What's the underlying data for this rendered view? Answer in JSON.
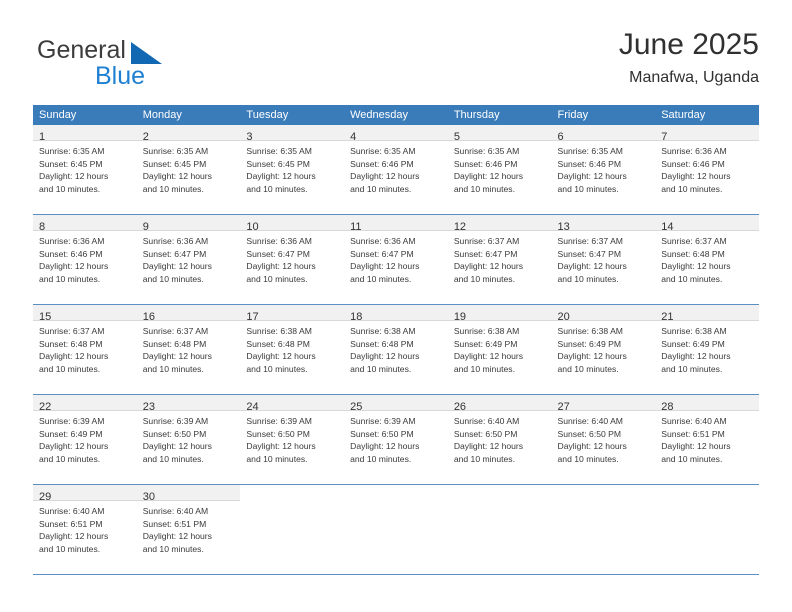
{
  "brand": {
    "name_part1": "General",
    "name_part2": "Blue",
    "triangle_icon": "brand-triangle-icon",
    "accent_color": "#1268b3",
    "blue_text_color": "#1f80d2"
  },
  "header": {
    "title": "June 2025",
    "subtitle": "Manafwa, Uganda"
  },
  "calendar": {
    "header_bg_color": "#3a7cba",
    "header_text_color": "#ffffff",
    "daynum_bg_color": "#f1f1f1",
    "grid_line_color": "#5b8fc4",
    "weekdays": [
      "Sunday",
      "Monday",
      "Tuesday",
      "Wednesday",
      "Thursday",
      "Friday",
      "Saturday"
    ],
    "weeks": [
      [
        {
          "day": "1",
          "sunrise": "Sunrise: 6:35 AM",
          "sunset": "Sunset: 6:45 PM",
          "daylight_line1": "Daylight: 12 hours",
          "daylight_line2": "and 10 minutes."
        },
        {
          "day": "2",
          "sunrise": "Sunrise: 6:35 AM",
          "sunset": "Sunset: 6:45 PM",
          "daylight_line1": "Daylight: 12 hours",
          "daylight_line2": "and 10 minutes."
        },
        {
          "day": "3",
          "sunrise": "Sunrise: 6:35 AM",
          "sunset": "Sunset: 6:45 PM",
          "daylight_line1": "Daylight: 12 hours",
          "daylight_line2": "and 10 minutes."
        },
        {
          "day": "4",
          "sunrise": "Sunrise: 6:35 AM",
          "sunset": "Sunset: 6:46 PM",
          "daylight_line1": "Daylight: 12 hours",
          "daylight_line2": "and 10 minutes."
        },
        {
          "day": "5",
          "sunrise": "Sunrise: 6:35 AM",
          "sunset": "Sunset: 6:46 PM",
          "daylight_line1": "Daylight: 12 hours",
          "daylight_line2": "and 10 minutes."
        },
        {
          "day": "6",
          "sunrise": "Sunrise: 6:35 AM",
          "sunset": "Sunset: 6:46 PM",
          "daylight_line1": "Daylight: 12 hours",
          "daylight_line2": "and 10 minutes."
        },
        {
          "day": "7",
          "sunrise": "Sunrise: 6:36 AM",
          "sunset": "Sunset: 6:46 PM",
          "daylight_line1": "Daylight: 12 hours",
          "daylight_line2": "and 10 minutes."
        }
      ],
      [
        {
          "day": "8",
          "sunrise": "Sunrise: 6:36 AM",
          "sunset": "Sunset: 6:46 PM",
          "daylight_line1": "Daylight: 12 hours",
          "daylight_line2": "and 10 minutes."
        },
        {
          "day": "9",
          "sunrise": "Sunrise: 6:36 AM",
          "sunset": "Sunset: 6:47 PM",
          "daylight_line1": "Daylight: 12 hours",
          "daylight_line2": "and 10 minutes."
        },
        {
          "day": "10",
          "sunrise": "Sunrise: 6:36 AM",
          "sunset": "Sunset: 6:47 PM",
          "daylight_line1": "Daylight: 12 hours",
          "daylight_line2": "and 10 minutes."
        },
        {
          "day": "11",
          "sunrise": "Sunrise: 6:36 AM",
          "sunset": "Sunset: 6:47 PM",
          "daylight_line1": "Daylight: 12 hours",
          "daylight_line2": "and 10 minutes."
        },
        {
          "day": "12",
          "sunrise": "Sunrise: 6:37 AM",
          "sunset": "Sunset: 6:47 PM",
          "daylight_line1": "Daylight: 12 hours",
          "daylight_line2": "and 10 minutes."
        },
        {
          "day": "13",
          "sunrise": "Sunrise: 6:37 AM",
          "sunset": "Sunset: 6:47 PM",
          "daylight_line1": "Daylight: 12 hours",
          "daylight_line2": "and 10 minutes."
        },
        {
          "day": "14",
          "sunrise": "Sunrise: 6:37 AM",
          "sunset": "Sunset: 6:48 PM",
          "daylight_line1": "Daylight: 12 hours",
          "daylight_line2": "and 10 minutes."
        }
      ],
      [
        {
          "day": "15",
          "sunrise": "Sunrise: 6:37 AM",
          "sunset": "Sunset: 6:48 PM",
          "daylight_line1": "Daylight: 12 hours",
          "daylight_line2": "and 10 minutes."
        },
        {
          "day": "16",
          "sunrise": "Sunrise: 6:37 AM",
          "sunset": "Sunset: 6:48 PM",
          "daylight_line1": "Daylight: 12 hours",
          "daylight_line2": "and 10 minutes."
        },
        {
          "day": "17",
          "sunrise": "Sunrise: 6:38 AM",
          "sunset": "Sunset: 6:48 PM",
          "daylight_line1": "Daylight: 12 hours",
          "daylight_line2": "and 10 minutes."
        },
        {
          "day": "18",
          "sunrise": "Sunrise: 6:38 AM",
          "sunset": "Sunset: 6:48 PM",
          "daylight_line1": "Daylight: 12 hours",
          "daylight_line2": "and 10 minutes."
        },
        {
          "day": "19",
          "sunrise": "Sunrise: 6:38 AM",
          "sunset": "Sunset: 6:49 PM",
          "daylight_line1": "Daylight: 12 hours",
          "daylight_line2": "and 10 minutes."
        },
        {
          "day": "20",
          "sunrise": "Sunrise: 6:38 AM",
          "sunset": "Sunset: 6:49 PM",
          "daylight_line1": "Daylight: 12 hours",
          "daylight_line2": "and 10 minutes."
        },
        {
          "day": "21",
          "sunrise": "Sunrise: 6:38 AM",
          "sunset": "Sunset: 6:49 PM",
          "daylight_line1": "Daylight: 12 hours",
          "daylight_line2": "and 10 minutes."
        }
      ],
      [
        {
          "day": "22",
          "sunrise": "Sunrise: 6:39 AM",
          "sunset": "Sunset: 6:49 PM",
          "daylight_line1": "Daylight: 12 hours",
          "daylight_line2": "and 10 minutes."
        },
        {
          "day": "23",
          "sunrise": "Sunrise: 6:39 AM",
          "sunset": "Sunset: 6:50 PM",
          "daylight_line1": "Daylight: 12 hours",
          "daylight_line2": "and 10 minutes."
        },
        {
          "day": "24",
          "sunrise": "Sunrise: 6:39 AM",
          "sunset": "Sunset: 6:50 PM",
          "daylight_line1": "Daylight: 12 hours",
          "daylight_line2": "and 10 minutes."
        },
        {
          "day": "25",
          "sunrise": "Sunrise: 6:39 AM",
          "sunset": "Sunset: 6:50 PM",
          "daylight_line1": "Daylight: 12 hours",
          "daylight_line2": "and 10 minutes."
        },
        {
          "day": "26",
          "sunrise": "Sunrise: 6:40 AM",
          "sunset": "Sunset: 6:50 PM",
          "daylight_line1": "Daylight: 12 hours",
          "daylight_line2": "and 10 minutes."
        },
        {
          "day": "27",
          "sunrise": "Sunrise: 6:40 AM",
          "sunset": "Sunset: 6:50 PM",
          "daylight_line1": "Daylight: 12 hours",
          "daylight_line2": "and 10 minutes."
        },
        {
          "day": "28",
          "sunrise": "Sunrise: 6:40 AM",
          "sunset": "Sunset: 6:51 PM",
          "daylight_line1": "Daylight: 12 hours",
          "daylight_line2": "and 10 minutes."
        }
      ],
      [
        {
          "day": "29",
          "sunrise": "Sunrise: 6:40 AM",
          "sunset": "Sunset: 6:51 PM",
          "daylight_line1": "Daylight: 12 hours",
          "daylight_line2": "and 10 minutes."
        },
        {
          "day": "30",
          "sunrise": "Sunrise: 6:40 AM",
          "sunset": "Sunset: 6:51 PM",
          "daylight_line1": "Daylight: 12 hours",
          "daylight_line2": "and 10 minutes."
        },
        null,
        null,
        null,
        null,
        null
      ]
    ]
  }
}
